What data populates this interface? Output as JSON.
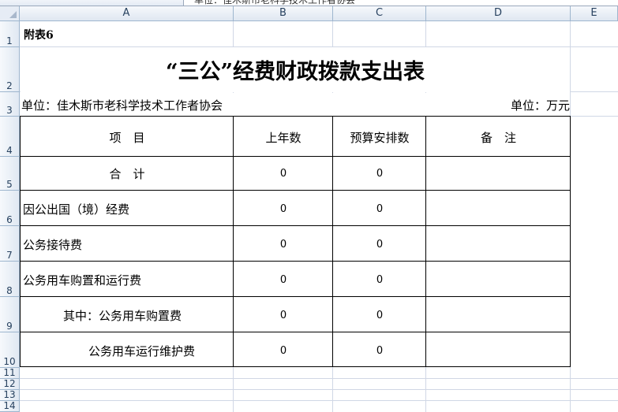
{
  "formula_bar": {
    "content": "单位：佳木斯市老科学技术工作者协会"
  },
  "columns": [
    "A",
    "B",
    "C",
    "D",
    "E"
  ],
  "rows": [
    "1",
    "2",
    "3",
    "4",
    "5",
    "6",
    "7",
    "8",
    "9",
    "10",
    "11",
    "12",
    "13",
    "14"
  ],
  "sheet": {
    "annex": "附表6",
    "title": "“三公”经费财政拨款支出表",
    "unit_left": "单位：佳木斯市老科学技术工作者协会",
    "unit_right": "单位：万元",
    "headers": {
      "item": "项　目",
      "last_year": "上年数",
      "budget": "预算安排数",
      "note": "备　注"
    },
    "table_rows": [
      {
        "label": "合　计",
        "last_year": "0",
        "budget": "0"
      },
      {
        "label": "因公出国（境）经费",
        "last_year": "0",
        "budget": "0"
      },
      {
        "label": "公务接待费",
        "last_year": "0",
        "budget": "0"
      },
      {
        "label": "公务用车购置和运行费",
        "last_year": "0",
        "budget": "0"
      },
      {
        "label": "其中：公务用车购置费",
        "last_year": "0",
        "budget": "0"
      },
      {
        "label": "公务用车运行维护费",
        "last_year": "0",
        "budget": "0"
      }
    ]
  }
}
